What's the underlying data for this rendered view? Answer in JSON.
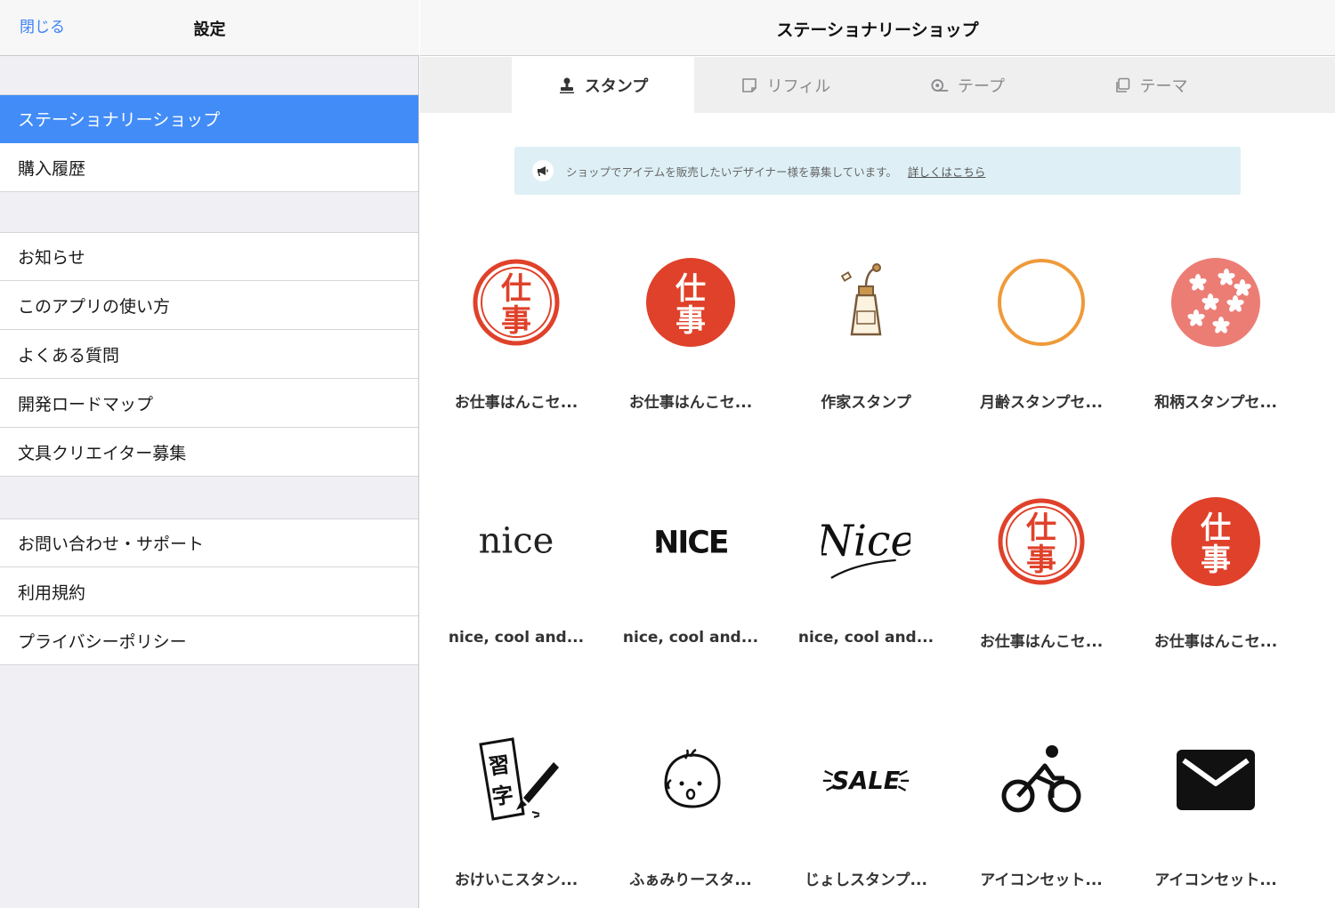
{
  "sidebar": {
    "close_label": "閉じる",
    "title": "設定",
    "groups": [
      {
        "items": [
          "ステーショナリーショップ",
          "購入履歴"
        ]
      },
      {
        "items": [
          "お知らせ",
          "このアプリの使い方",
          "よくある質問",
          "開発ロードマップ",
          "文具クリエイター募集"
        ]
      },
      {
        "items": [
          "お問い合わせ・サポート",
          "利用規約",
          "プライバシーポリシー"
        ]
      }
    ],
    "selected": "ステーショナリーショップ"
  },
  "shop": {
    "title": "ステーショナリーショップ",
    "tabs": [
      {
        "label": "スタンプ",
        "icon": "stamp-icon",
        "active": true
      },
      {
        "label": "リフィル",
        "icon": "note-icon",
        "active": false
      },
      {
        "label": "テープ",
        "icon": "tape-icon",
        "active": false
      },
      {
        "label": "テーマ",
        "icon": "theme-icon",
        "active": false
      }
    ],
    "banner": {
      "icon": "megaphone-icon",
      "text": "ショップでアイテムを販売したいデザイナー様を募集しています。",
      "link": "詳しくはこちら"
    },
    "items": [
      {
        "label": "お仕事はんこセ...",
        "thumb": "shigoto-outline",
        "glyphs": [
          "仕",
          "事"
        ]
      },
      {
        "label": "お仕事はんこセ...",
        "thumb": "shigoto-filled",
        "glyphs": [
          "仕",
          "事"
        ]
      },
      {
        "label": "作家スタンプ",
        "thumb": "glue-tube"
      },
      {
        "label": "月齢スタンプセ...",
        "thumb": "orange-circle"
      },
      {
        "label": "和柄スタンプセ...",
        "thumb": "sakura-circle"
      },
      {
        "label": "nice, cool and...",
        "thumb": "nice-serif",
        "glyphs": [
          "nice"
        ]
      },
      {
        "label": "nice, cool and...",
        "thumb": "nice-block",
        "glyphs": [
          "NICE"
        ]
      },
      {
        "label": "nice, cool and...",
        "thumb": "nice-script",
        "glyphs": [
          "Nice"
        ]
      },
      {
        "label": "お仕事はんこセ...",
        "thumb": "shigoto-outline",
        "glyphs": [
          "仕",
          "事"
        ]
      },
      {
        "label": "お仕事はんこセ...",
        "thumb": "shigoto-filled",
        "glyphs": [
          "仕",
          "事"
        ]
      },
      {
        "label": "おけいこスタン...",
        "thumb": "calligraphy",
        "glyphs": [
          "習",
          "字"
        ]
      },
      {
        "label": "ふぁみりースタ...",
        "thumb": "baby-face"
      },
      {
        "label": "じょしスタンプ...",
        "thumb": "sale",
        "glyphs": [
          "SALE"
        ]
      },
      {
        "label": "アイコンセット...",
        "thumb": "bicycle-icon"
      },
      {
        "label": "アイコンセット...",
        "thumb": "mail-icon"
      }
    ]
  },
  "colors": {
    "accent": "#428cf7",
    "link": "#3b82f6",
    "stamp_red": "#e0412a",
    "orange": "#ef9a3a",
    "sakura": "#ec7d75",
    "banner_bg": "#def0f6"
  }
}
